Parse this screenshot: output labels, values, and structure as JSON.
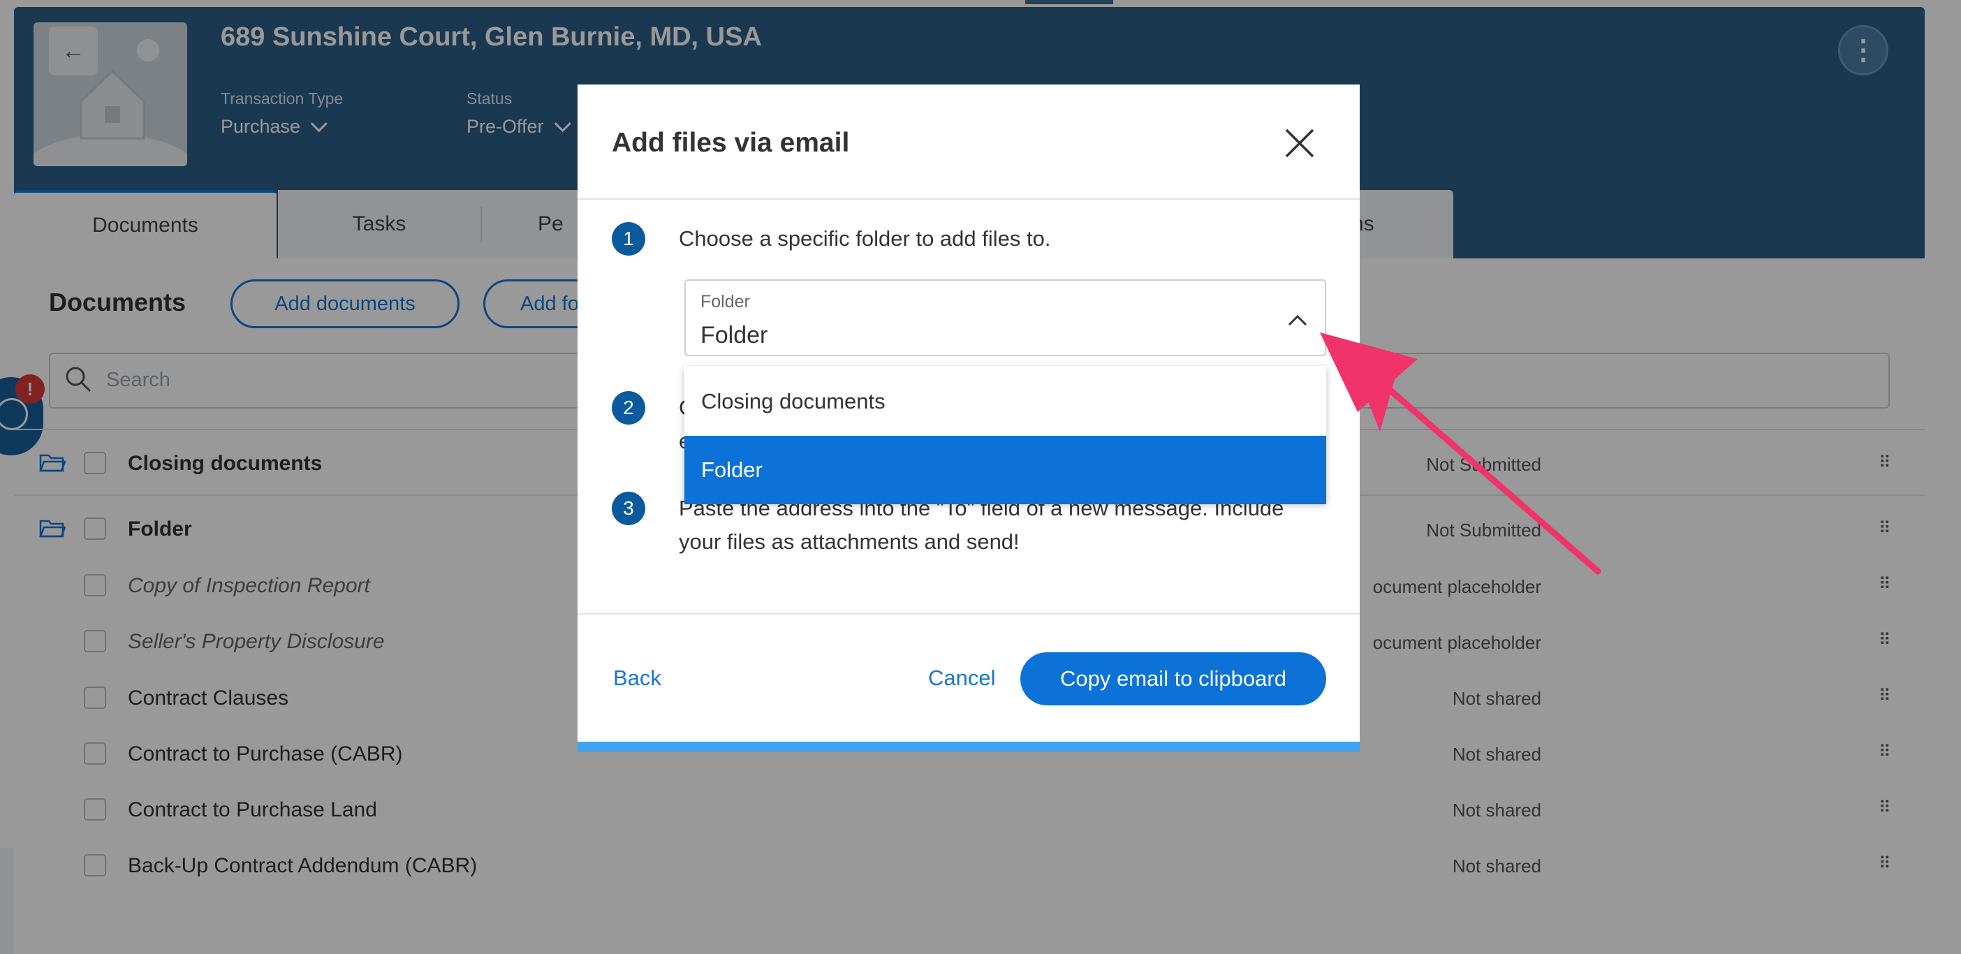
{
  "header": {
    "address": "689 Sunshine Court, Glen Burnie, MD, USA",
    "transaction_type_label": "Transaction Type",
    "transaction_type_value": "Purchase",
    "status_label": "Status",
    "status_value": "Pre-Offer"
  },
  "tabs": [
    {
      "label": "Documents",
      "active": true
    },
    {
      "label": "Tasks"
    },
    {
      "label": "Pe"
    },
    {
      "label": "ns"
    }
  ],
  "documents": {
    "title": "Documents",
    "add_documents_label": "Add documents",
    "add_folder_label": "Add fo",
    "search_placeholder": "Search",
    "badge_count": "!",
    "rows": [
      {
        "name": "Closing documents",
        "status": "Not Submitted"
      },
      {
        "name": "Folder",
        "status": "Not Submitted"
      },
      {
        "name": "Copy of Inspection Report",
        "status": "ocument placeholder"
      },
      {
        "name": "Seller's Property Disclosure",
        "status": "ocument placeholder"
      },
      {
        "name": "Contract Clauses",
        "status": "Not shared"
      },
      {
        "name": "Contract to Purchase (CABR)",
        "status": "Not shared"
      },
      {
        "name": "Contract to Purchase Land",
        "status": "Not shared"
      },
      {
        "name": "Back-Up Contract Addendum (CABR)",
        "status": "Not shared"
      }
    ]
  },
  "modal": {
    "title": "Add files via email",
    "steps": [
      {
        "number": "1",
        "text": "Choose a specific folder to add files to."
      },
      {
        "number": "2",
        "text_visible_start": "C",
        "text_visible_line2": "e"
      },
      {
        "number": "3",
        "text": "Paste the address into the \"To\" field of a new message. Include your files as attachments and send!"
      }
    ],
    "folder_select": {
      "label": "Folder",
      "value": "Folder",
      "options": [
        "Closing documents",
        "Folder"
      ],
      "selected": "Folder"
    },
    "back_label": "Back",
    "cancel_label": "Cancel",
    "copy_label": "Copy email to clipboard"
  },
  "colors": {
    "header_bg": "#2c5f87",
    "primary": "#0c72d8",
    "step_badge": "#0c5a9e",
    "annotation_arrow": "#f0336b"
  }
}
